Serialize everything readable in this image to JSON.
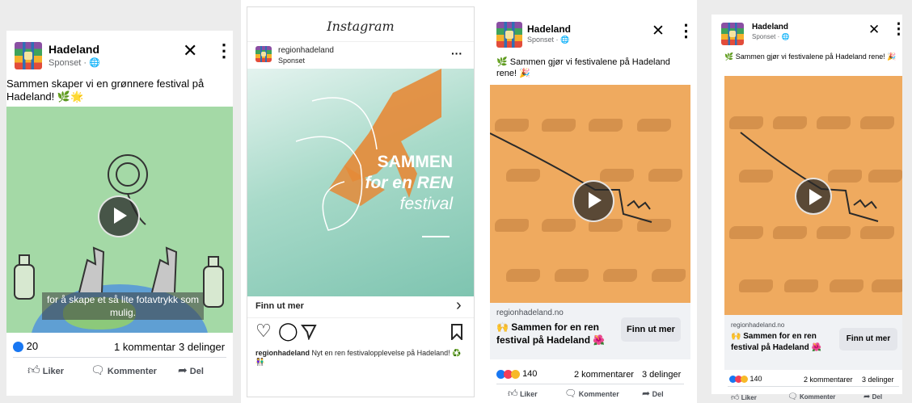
{
  "colors": {
    "facebook_blue": "#1877f2",
    "green_media": "#a4d9a6",
    "teal_media": "#8ccbb8",
    "orange_media": "#efaa5f",
    "cta_bg": "#e4e6eb"
  },
  "post1": {
    "page_name": "Hadeland",
    "sponsored": "Sponset · ",
    "icons": [
      "close-icon",
      "more-vertical-icon",
      "globe-icon",
      "play-icon",
      "like-icon",
      "comment-icon",
      "share-icon"
    ],
    "caption": "Sammen skaper vi en grønnere festival på Hadeland! ",
    "caption_emoji": "🌿🌟",
    "subtitle": "for å skape et så lite fotavtrykk som mulig.",
    "reactions_count": "20",
    "comments": "1 kommentar",
    "shares": "3 delinger",
    "actions": {
      "like": "Liker",
      "comment": "Kommenter",
      "share": "Del"
    }
  },
  "post2": {
    "app_title": "Instagram",
    "username": "regionhadeland",
    "sponsored": "Sponset",
    "more": "···",
    "headline_line1": "SAMMEN",
    "headline_line2": "for en REN",
    "headline_line3": "festival",
    "cta": "Finn ut mer",
    "cta_arrow": "›",
    "caption_user": "regionhadeland",
    "caption_text": " Nyt en ren festivalopplevelse på Hadeland! ",
    "caption_emoji": "♻️👫",
    "icons": [
      "heart-icon",
      "comment-icon",
      "send-icon",
      "bookmark-icon"
    ]
  },
  "post3": {
    "page_name": "Hadeland",
    "sponsored": "Sponset · ",
    "caption": "🌿 Sammen gjør vi festivalene på Hadeland rene! ",
    "caption_emoji": "🎉",
    "link_domain": "regionhadeland.no",
    "link_title": "🙌 Sammen for en ren festival på Hadeland 🌺",
    "cta": "Finn ut mer",
    "reactions_count": "140",
    "comments": "2 kommentarer",
    "shares": "3 delinger",
    "actions": {
      "like": "Liker",
      "comment": "Kommenter",
      "share": "Del"
    }
  },
  "post4": {
    "page_name": "Hadeland",
    "sponsored": "Sponset · ",
    "caption": "🌿 Sammen gjør vi festivalene på Hadeland rene! ",
    "caption_emoji": "🎉",
    "link_domain": "regionhadeland.no",
    "link_title": "🙌 Sammen for en ren festival på Hadeland 🌺",
    "cta": "Finn ut mer",
    "reactions_count": "140",
    "comments": "2 kommentarer",
    "shares": "3 delinger",
    "actions": {
      "like": "Liker",
      "comment": "Kommenter",
      "share": "Del"
    }
  }
}
